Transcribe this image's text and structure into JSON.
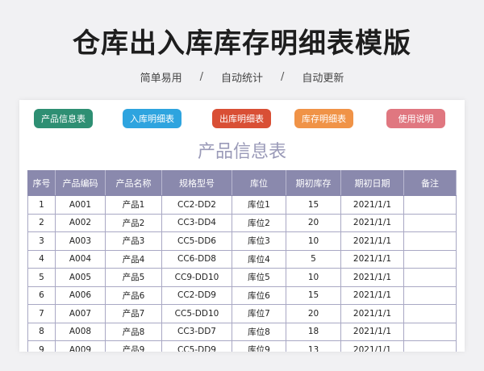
{
  "header": {
    "title": "仓库出入库库存明细表模版",
    "subtitle": [
      "简单易用",
      "自动统计",
      "自动更新"
    ],
    "separator": "/"
  },
  "buttons": [
    {
      "label": "产品信息表",
      "color": "#2e8f73"
    },
    {
      "label": "入库明细表",
      "color": "#2ea4df"
    },
    {
      "label": "出库明细表",
      "color": "#d94f35"
    },
    {
      "label": "库存明细表",
      "color": "#f09347"
    },
    {
      "label": "使用说明",
      "color": "#e07780"
    }
  ],
  "sheet": {
    "title": "产品信息表",
    "columns": [
      "序号",
      "产品编码",
      "产品名称",
      "规格型号",
      "库位",
      "期初库存",
      "期初日期",
      "备注"
    ],
    "rows": [
      [
        "1",
        "A001",
        "产品1",
        "CC2-DD2",
        "库位1",
        "15",
        "2021/1/1",
        ""
      ],
      [
        "2",
        "A002",
        "产品2",
        "CC3-DD4",
        "库位2",
        "20",
        "2021/1/1",
        ""
      ],
      [
        "3",
        "A003",
        "产品3",
        "CC5-DD6",
        "库位3",
        "10",
        "2021/1/1",
        ""
      ],
      [
        "4",
        "A004",
        "产品4",
        "CC6-DD8",
        "库位4",
        "5",
        "2021/1/1",
        ""
      ],
      [
        "5",
        "A005",
        "产品5",
        "CC9-DD10",
        "库位5",
        "10",
        "2021/1/1",
        ""
      ],
      [
        "6",
        "A006",
        "产品6",
        "CC2-DD9",
        "库位6",
        "15",
        "2021/1/1",
        ""
      ],
      [
        "7",
        "A007",
        "产品7",
        "CC5-DD10",
        "库位7",
        "20",
        "2021/1/1",
        ""
      ],
      [
        "8",
        "A008",
        "产品8",
        "CC3-DD7",
        "库位8",
        "18",
        "2021/1/1",
        ""
      ],
      [
        "9",
        "A009",
        "产品9",
        "CC5-DD9",
        "库位9",
        "13",
        "2021/1/1",
        ""
      ]
    ]
  }
}
